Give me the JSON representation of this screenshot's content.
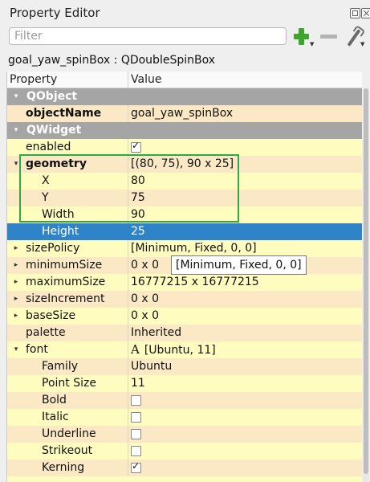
{
  "window": {
    "title": "Property Editor"
  },
  "filter": {
    "placeholder": "Filter",
    "value": ""
  },
  "toolbar": {
    "add_icon": "plus-icon",
    "remove_icon": "minus-icon",
    "configure_icon": "wrench-icon"
  },
  "object_line": "goal_yaw_spinBox : QDoubleSpinBox",
  "table": {
    "headers": [
      "Property",
      "Value"
    ],
    "rows": [
      {
        "type": "group",
        "name": "QObject",
        "expander": "down"
      },
      {
        "type": "prop",
        "name": "objectName",
        "value": "goal_yaw_spinBox",
        "bold": true,
        "style": "hl",
        "indent": 1
      },
      {
        "type": "group",
        "name": "QWidget",
        "expander": "down"
      },
      {
        "type": "check",
        "name": "enabled",
        "checked": true,
        "indent": 1
      },
      {
        "type": "prop",
        "name": "geometry",
        "value": "[(80, 75), 90 x 25]",
        "bold": true,
        "expander": "down",
        "style": "hl",
        "indent": 1
      },
      {
        "type": "prop",
        "name": "X",
        "value": "80",
        "indent": 2
      },
      {
        "type": "prop",
        "name": "Y",
        "value": "75",
        "indent": 2,
        "style": "hl"
      },
      {
        "type": "prop",
        "name": "Width",
        "value": "90",
        "indent": 2
      },
      {
        "type": "prop",
        "name": "Height",
        "value": "25",
        "indent": 2,
        "style": "sel"
      },
      {
        "type": "prop",
        "name": "sizePolicy",
        "value": "[Minimum, Fixed, 0, 0]",
        "expander": "right",
        "indent": 1
      },
      {
        "type": "prop",
        "name": "minimumSize",
        "value": "0 x 0",
        "expander": "right",
        "indent": 1,
        "style": "hl"
      },
      {
        "type": "prop",
        "name": "maximumSize",
        "value": "16777215 x 16777215",
        "expander": "right",
        "indent": 1
      },
      {
        "type": "prop",
        "name": "sizeIncrement",
        "value": "0 x 0",
        "expander": "right",
        "indent": 1,
        "style": "hl"
      },
      {
        "type": "prop",
        "name": "baseSize",
        "value": "0 x 0",
        "expander": "right",
        "indent": 1
      },
      {
        "type": "prop",
        "name": "palette",
        "value": "Inherited",
        "indent": 1,
        "style": "hl"
      },
      {
        "type": "prop",
        "name": "font",
        "value": "[Ubuntu, 11]",
        "expander": "down",
        "indent": 1,
        "font_glyph": "A"
      },
      {
        "type": "prop",
        "name": "Family",
        "value": "Ubuntu",
        "indent": 2,
        "style": "hl"
      },
      {
        "type": "prop",
        "name": "Point Size",
        "value": "11",
        "indent": 2
      },
      {
        "type": "check",
        "name": "Bold",
        "checked": false,
        "indent": 2,
        "style": "hl"
      },
      {
        "type": "check",
        "name": "Italic",
        "checked": false,
        "indent": 2
      },
      {
        "type": "check",
        "name": "Underline",
        "checked": false,
        "indent": 2,
        "style": "hl"
      },
      {
        "type": "check",
        "name": "Strikeout",
        "checked": false,
        "indent": 2
      },
      {
        "type": "check",
        "name": "Kerning",
        "checked": true,
        "indent": 2,
        "style": "hl"
      }
    ]
  },
  "tooltip": "[Minimum, Fixed, 0, 0]",
  "colors": {
    "group_header": "#a5a5a5",
    "row_bg": "#fffcbf",
    "row_alt": "#fbe9c5",
    "selection": "#2f83c9",
    "highlight_box": "#2ea84a"
  }
}
